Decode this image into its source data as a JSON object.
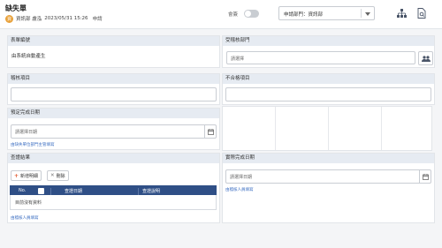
{
  "header": {
    "title": "缺失單",
    "avatar_text": "資",
    "user": "資訊部 盧泓",
    "datetime": "2023/05/31 15:26",
    "status": "申請",
    "cc_label": "會簽",
    "cc_enabled": false,
    "dept_select": "申請部門：資訊部"
  },
  "form": {
    "form_number": {
      "label": "表單編號",
      "value": "由系統自動產生"
    },
    "inspection_dept": {
      "label": "受稽核部門",
      "placeholder": "請選擇"
    },
    "audit_item": {
      "label": "稽核項目"
    },
    "nonconformity": {
      "label": "不合格項目"
    },
    "planned_date": {
      "label": "預定完成日期",
      "placeholder": "請選擇日期",
      "hint": "由缺失單位部門主管填寫"
    },
    "audit_result": {
      "label": "查證結果",
      "add_label": "新增明細",
      "delete_label": "刪除",
      "columns": [
        "No.",
        "查證日期",
        "查證說明"
      ],
      "empty_text": "目前沒有資料",
      "hint": "由稽核人員填寫"
    },
    "actual_date": {
      "label": "實際完成日期",
      "placeholder": "請選擇日期",
      "hint": "由稽核人員填寫"
    }
  },
  "colors": {
    "header_band": "#e6ebf2",
    "table_header": "#2f4f86",
    "link": "#3b6ec2",
    "accent": "#e0552b"
  }
}
